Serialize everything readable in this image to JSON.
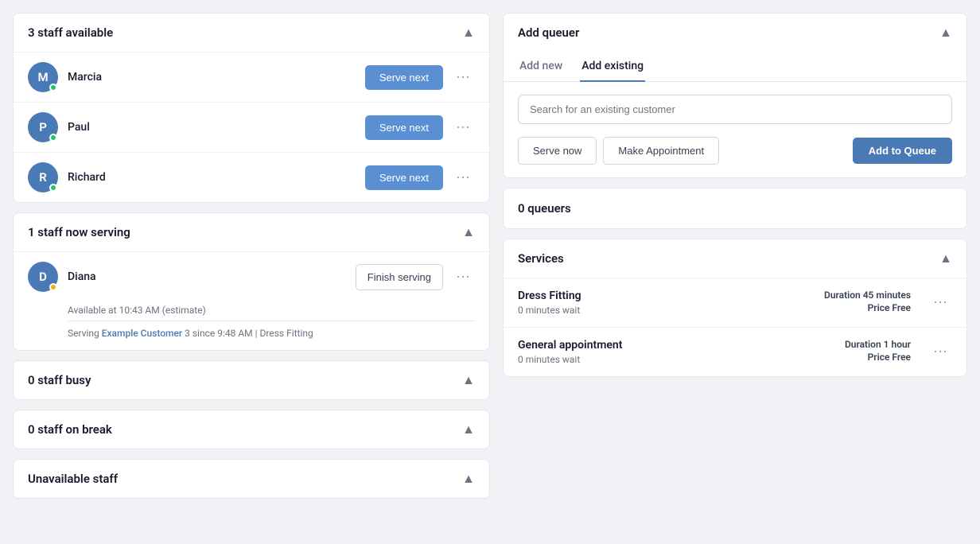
{
  "left": {
    "available_section": {
      "title": "3 staff available",
      "staff": [
        {
          "id": "marcia",
          "name": "Marcia",
          "initial": "M",
          "status": "green"
        },
        {
          "id": "paul",
          "name": "Paul",
          "initial": "P",
          "status": "green"
        },
        {
          "id": "richard",
          "name": "Richard",
          "initial": "R",
          "status": "green"
        }
      ],
      "serve_next_label": "Serve next"
    },
    "serving_section": {
      "title": "1 staff now serving",
      "staff": [
        {
          "id": "diana",
          "name": "Diana",
          "initial": "D",
          "status": "yellow",
          "available_at": "Available at 10:43 AM (estimate)",
          "serving_info": "3 since 9:48 AM | Dress Fitting",
          "serving_customer": "Example Customer",
          "serving_prefix": "Serving ",
          "serving_suffix": ""
        }
      ],
      "finish_serving_label": "Finish serving"
    },
    "busy_section": {
      "title": "0 staff busy"
    },
    "break_section": {
      "title": "0 staff on break"
    },
    "unavailable_section": {
      "title": "Unavailable staff"
    }
  },
  "right": {
    "add_queuer": {
      "title": "Add queuer",
      "tabs": [
        {
          "id": "add-new",
          "label": "Add new"
        },
        {
          "id": "add-existing",
          "label": "Add existing"
        }
      ],
      "active_tab": "add-existing",
      "search_placeholder": "Search for an existing customer",
      "buttons": {
        "serve_now": "Serve now",
        "make_appointment": "Make Appointment",
        "add_to_queue": "Add to Queue"
      }
    },
    "queuers": {
      "title": "0 queuers"
    },
    "services": {
      "title": "Services",
      "items": [
        {
          "id": "dress-fitting",
          "name": "Dress Fitting",
          "wait": "0 minutes wait",
          "duration_label": "Duration",
          "duration_value": "45 minutes",
          "price_label": "Price",
          "price_value": "Free"
        },
        {
          "id": "general-appointment",
          "name": "General appointment",
          "wait": "0 minutes wait",
          "duration_label": "Duration",
          "duration_value": "1 hour",
          "price_label": "Price",
          "price_value": "Free"
        }
      ]
    }
  }
}
